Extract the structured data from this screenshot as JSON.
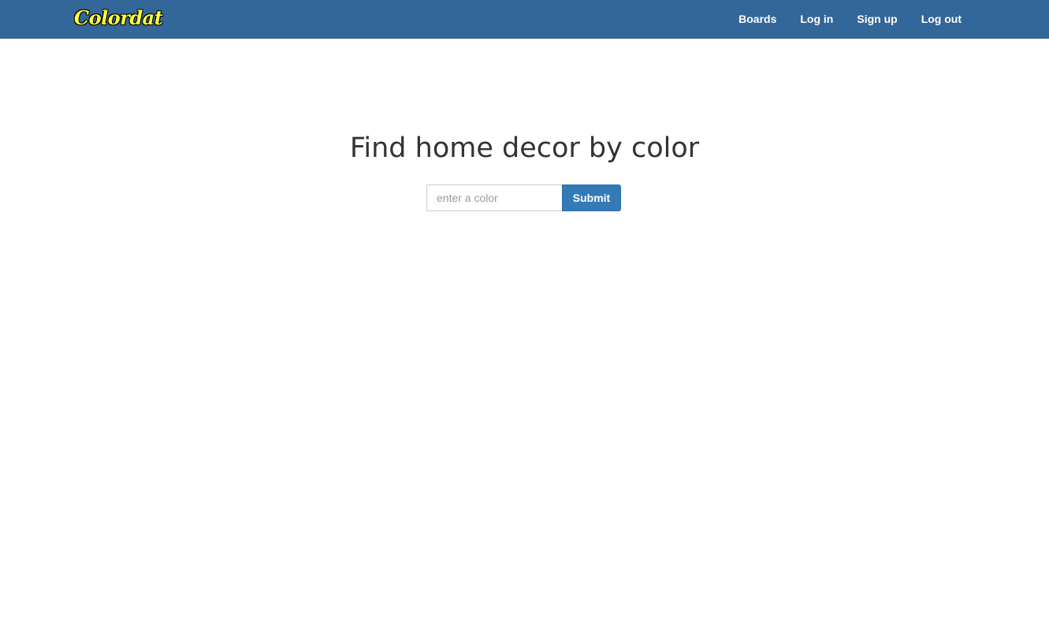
{
  "navbar": {
    "brand": "Colordat",
    "links": [
      {
        "label": "Boards"
      },
      {
        "label": "Log in"
      },
      {
        "label": "Sign up"
      },
      {
        "label": "Log out"
      }
    ]
  },
  "hero": {
    "title": "Find home decor by color"
  },
  "search": {
    "placeholder": "enter a color",
    "value": "",
    "submit_label": "Submit"
  },
  "colors": {
    "navbar_bg": "#336699",
    "brand_text": "#ffff3b",
    "button_bg": "#337ab7",
    "title_text": "#333333"
  }
}
